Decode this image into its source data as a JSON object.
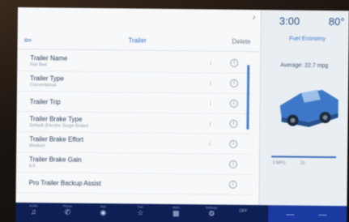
{
  "status": {
    "time": "3:00",
    "temperature": "80°",
    "corner_glyph": "♪"
  },
  "header": {
    "back_icon": "back-arrow-icon",
    "title": "Trailer",
    "delete_label": "Delete"
  },
  "settings": [
    {
      "label": "Trailer Name",
      "sub": "Flat Bed"
    },
    {
      "label": "Trailer Type",
      "sub": "Conventional"
    },
    {
      "label": "Trailer Trip",
      "sub": ""
    },
    {
      "label": "Trailer Brake Type",
      "sub": "Default (Electric Surge Brake)"
    },
    {
      "label": "Trailer Brake Effort",
      "sub": "Medium"
    },
    {
      "label": "Trailer Brake Gain",
      "sub": "6.5"
    },
    {
      "label": "Pro Trailer Backup Assist",
      "sub": ""
    }
  ],
  "row_controls": {
    "info_glyph": "i",
    "control_glyph": "ⓘ"
  },
  "fuel": {
    "title": "Fuel Economy",
    "average": "Average: 22.7 mpg",
    "bar_left": "0 MPG",
    "bar_mid": "15"
  },
  "dock": {
    "items": [
      {
        "label": "Audio",
        "icon": "♫"
      },
      {
        "label": "Phone",
        "icon": "✆"
      },
      {
        "label": "Nav",
        "icon": "◉"
      },
      {
        "label": "Fav",
        "icon": "☆"
      },
      {
        "label": "Apps",
        "icon": "▦"
      },
      {
        "label": "Settings",
        "icon": "⚙"
      }
    ],
    "aux_label": "OFF"
  },
  "colors": {
    "accent": "#3a74c4",
    "dock": "#0e1f55",
    "dock_right": "#1b3aa1",
    "truck": "#3d78c8"
  }
}
